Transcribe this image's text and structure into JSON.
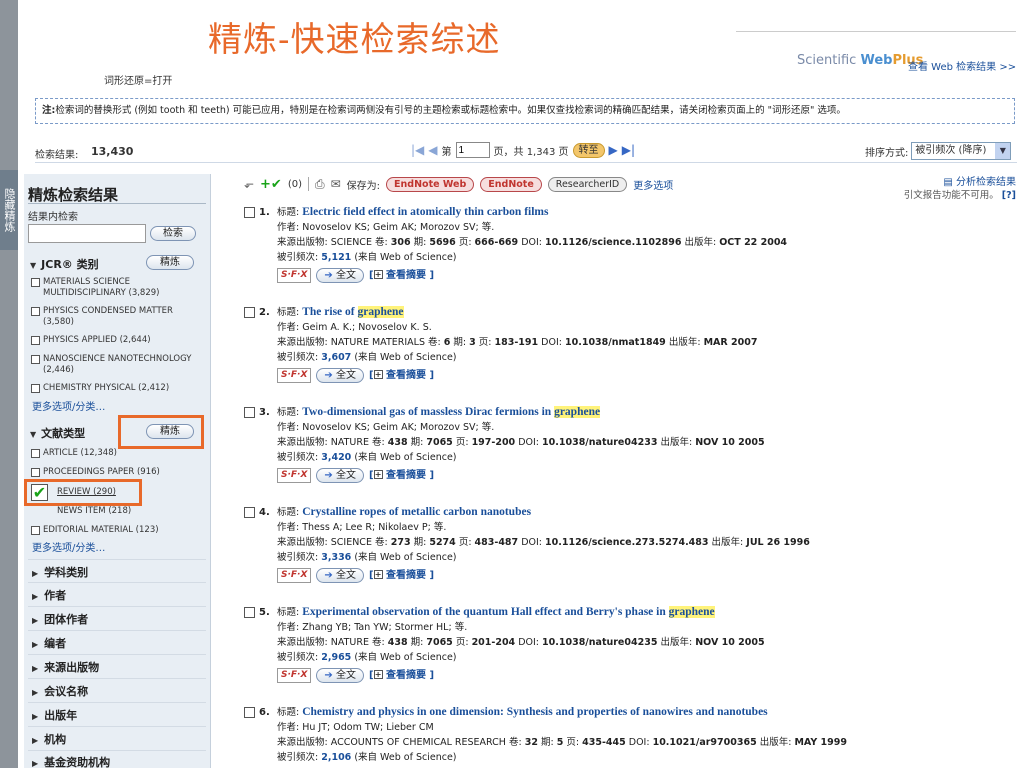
{
  "slide_title": "精炼-快速检索综述",
  "stemming_note": "词形还原=打开",
  "webplus": {
    "brand_prefix": "Scientific",
    "brand_web": "Web",
    "brand_plus": "Plus",
    "link": "查看 Web 检索结果 >>"
  },
  "notice": {
    "label": "注:",
    "text": "检索词的替换形式 (例如 tooth 和 teeth) 可能已应用，特别是在检索词两侧没有引号的主题检索或标题检索中。如果仅查找检索词的精确匹配结果，请关闭检索页面上的 \"词形还原\" 选项。"
  },
  "results": {
    "count_label": "检索结果:",
    "count": "13,430",
    "page_prefix": "第",
    "page_value": "1",
    "page_suffix": "页，共 1,343 页",
    "go_label": "转至"
  },
  "sort": {
    "label": "排序方式:",
    "selected": "被引频次 (降序)"
  },
  "sidebar": {
    "hide_tab": "隐藏精炼",
    "title": "精炼检索结果",
    "within_label": "结果内检索",
    "search_button": "检索",
    "jcr_section": "JCR® 类别",
    "refine_button": "精炼",
    "jcr_items": [
      "MATERIALS SCIENCE MULTIDISCIPLINARY (3,829)",
      "PHYSICS CONDENSED MATTER (3,580)",
      "PHYSICS APPLIED (2,644)",
      "NANOSCIENCE NANOTECHNOLOGY (2,446)",
      "CHEMISTRY PHYSICAL (2,412)"
    ],
    "more_options": "更多选项/分类…",
    "doctype_section": "文献类型",
    "doctype_refine_button": "精炼",
    "doctype_items": [
      "ARTICLE (12,348)",
      "PROCEEDINGS PAPER (916)",
      "REVIEW (290)",
      "NEWS ITEM (218)",
      "EDITORIAL MATERIAL (123)"
    ],
    "doctype_more": "更多选项/分类…",
    "facets": [
      "学科类别",
      "作者",
      "团体作者",
      "编者",
      "来源出版物",
      "会议名称",
      "出版年",
      "机构",
      "基金资助机构"
    ]
  },
  "toolbar": {
    "marked_count": "(0)",
    "save_label": "保存为:",
    "endnote_web": "EndNote Web",
    "endnote": "EndNote",
    "researcherid": "ResearcherID",
    "more_options": "更多选项",
    "analyze": "分析检索结果",
    "citation_report": "引文报告功能不可用。",
    "help": "[?]"
  },
  "labels": {
    "title": "标题:",
    "authors": "作者:",
    "source": "来源出版物:",
    "volume": "卷:",
    "issue": "期:",
    "pages": "页:",
    "doi": "DOI:",
    "pubdate": "出版年:",
    "cited": "被引频次:",
    "cited_from": "(来自 Web of Science)",
    "sfx": "S·F·X",
    "fulltext": "全文",
    "abstract": "查看摘要"
  },
  "records": [
    {
      "num": "1.",
      "title_pre": "Electric field effect in atomically thin carbon films",
      "title_hl": "",
      "title_post": "",
      "authors": "Novoselov KS; Geim AK; Morozov SV; 等.",
      "source": "SCIENCE",
      "volume": "306",
      "issue": "5696",
      "pages": "666-669",
      "doi": "10.1126/science.1102896",
      "pubdate": "OCT 22 2004",
      "cited": "5,121"
    },
    {
      "num": "2.",
      "title_pre": "The rise of ",
      "title_hl": "graphene",
      "title_post": "",
      "authors": "Geim A. K.; Novoselov K. S.",
      "source": "NATURE MATERIALS",
      "volume": "6",
      "issue": "3",
      "pages": "183-191",
      "doi": "10.1038/nmat1849",
      "pubdate": "MAR 2007",
      "cited": "3,607"
    },
    {
      "num": "3.",
      "title_pre": "Two-dimensional gas of massless Dirac fermions in ",
      "title_hl": "graphene",
      "title_post": "",
      "authors": "Novoselov KS; Geim AK; Morozov SV; 等.",
      "source": "NATURE",
      "volume": "438",
      "issue": "7065",
      "pages": "197-200",
      "doi": "10.1038/nature04233",
      "pubdate": "NOV 10 2005",
      "cited": "3,420"
    },
    {
      "num": "4.",
      "title_pre": "Crystalline ropes of metallic carbon nanotubes",
      "title_hl": "",
      "title_post": "",
      "authors": "Thess A; Lee R; Nikolaev P; 等.",
      "source": "SCIENCE",
      "volume": "273",
      "issue": "5274",
      "pages": "483-487",
      "doi": "10.1126/science.273.5274.483",
      "pubdate": "JUL 26 1996",
      "cited": "3,336"
    },
    {
      "num": "5.",
      "title_pre": "Experimental observation of the quantum Hall effect and Berry's phase in ",
      "title_hl": "graphene",
      "title_post": "",
      "authors": "Zhang YB; Tan YW; Stormer HL; 等.",
      "source": "NATURE",
      "volume": "438",
      "issue": "7065",
      "pages": "201-204",
      "doi": "10.1038/nature04235",
      "pubdate": "NOV 10 2005",
      "cited": "2,965"
    },
    {
      "num": "6.",
      "title_pre": "Chemistry and physics in one dimension: Synthesis and properties of nanowires and nanotubes",
      "title_hl": "",
      "title_post": "",
      "authors": "Hu JT; Odom TW; Lieber CM",
      "source": "ACCOUNTS OF CHEMICAL RESEARCH",
      "volume": "32",
      "issue": "5",
      "pages": "435-445",
      "doi": "10.1021/ar9700365",
      "pubdate": "MAY 1999",
      "cited": "2,106"
    }
  ]
}
